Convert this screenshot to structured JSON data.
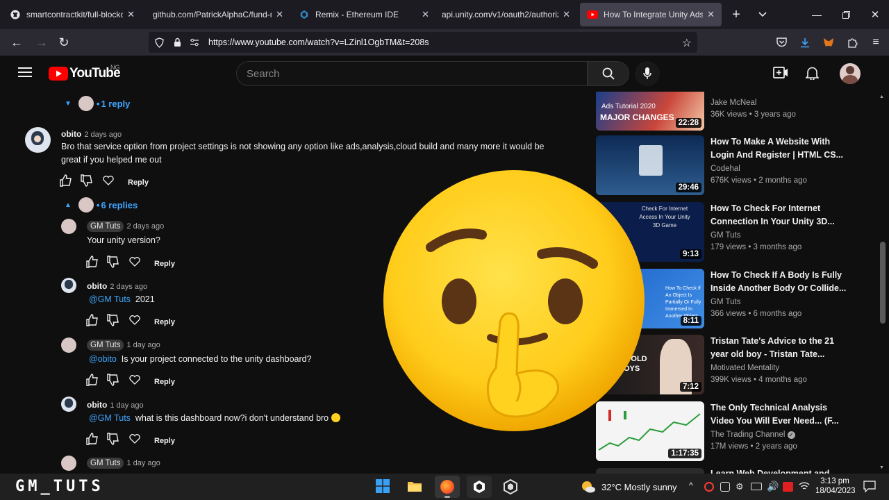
{
  "browser": {
    "tabs": [
      {
        "label": "smartcontractkit/full-blockcha",
        "icon": "github-icon"
      },
      {
        "label": "github.com/PatrickAlphaC/fund-m",
        "icon": "blank-icon"
      },
      {
        "label": "Remix - Ethereum IDE",
        "icon": "remix-icon"
      },
      {
        "label": "api.unity.com/v1/oauth2/authoriz",
        "icon": "blank-icon"
      },
      {
        "label": "How To Integrate Unity Ads In",
        "icon": "youtube-icon"
      }
    ],
    "url": "https://www.youtube.com/watch?v=LZinl1OgbTM&t=208s"
  },
  "youtube": {
    "logo": "YouTube",
    "country": "NG",
    "search_placeholder": "Search"
  },
  "comments": {
    "first_toggle": "1 reply",
    "main": {
      "author": "obito",
      "time": "2 days ago",
      "text": "Bro that service option from project settings is not showing any option like ads,analysis,cloud build and many more it would be great if you helped me out",
      "reply_label": "Reply",
      "replies_toggle": "6 replies"
    },
    "replies": [
      {
        "author": "GM Tuts",
        "time": "2 days ago",
        "mention": "",
        "text": "Your unity version?",
        "reply_label": "Reply"
      },
      {
        "author": "obito",
        "time": "2 days ago",
        "mention": "@GM Tuts",
        "text": "2021",
        "reply_label": "Reply"
      },
      {
        "author": "GM Tuts",
        "time": "1 day ago",
        "mention": "@obito",
        "text": "Is your project connected to the unity dashboard?",
        "reply_label": "Reply"
      },
      {
        "author": "obito",
        "time": "1 day ago",
        "mention": "@GM Tuts",
        "text": "what is this dashboard now?i don't understand bro",
        "reply_label": "Reply"
      },
      {
        "author": "GM Tuts",
        "time": "1 day ago",
        "mention": "",
        "text": "",
        "reply_label": ""
      }
    ]
  },
  "sidebar": [
    {
      "title_line1": "",
      "title_line2": "",
      "channel": "Jake McNeal",
      "meta": "36K views • 3 years ago",
      "duration": "22:28",
      "thumb_text1": "Ads Tutorial 2020",
      "thumb_text2": "MAJOR CHANGES"
    },
    {
      "title_line1": "How To Make A Website With",
      "title_line2": "Login And Register | HTML CS...",
      "channel": "Codehal",
      "meta": "676K views • 2 months ago",
      "duration": "29:46"
    },
    {
      "title_line1": "How To Check For Internet",
      "title_line2": "Connection In Your Unity 3D...",
      "channel": "GM Tuts",
      "meta": "179 views • 3 months ago",
      "duration": "9:13",
      "thumb_text1": "Check For Internet Access In Your Unity 3D Game"
    },
    {
      "title_line1": "How To Check If A Body Is Fully",
      "title_line2": "Inside Another Body Or Collide...",
      "channel": "GM Tuts",
      "meta": "366 views • 6 months ago",
      "duration": "8:11",
      "thumb_text1": "How To Check If An Object Is Partially Or Fully Immersed In Another Object"
    },
    {
      "title_line1": "Tristan Tate's Advice to the 21",
      "title_line2": "year old boy - Tristan Tate...",
      "channel": "Motivated Mentality",
      "meta": "399K views • 4 months ago",
      "duration": "7:12",
      "thumb_text1": "E OLD OYS"
    },
    {
      "title_line1": "The Only Technical Analysis",
      "title_line2": "Video You Will Ever Need... (F...",
      "channel": "The Trading Channel",
      "meta": "17M views • 2 years ago",
      "duration": "1:17:35"
    },
    {
      "title_line1": "Learn Web Development and",
      "title_line2": "",
      "channel": "",
      "meta": "",
      "duration": ""
    }
  ],
  "watermark": "GM_TUTS",
  "taskbar": {
    "weather": "32°C  Mostly sunny",
    "time": "3:13 pm",
    "date": "18/04/2023"
  },
  "colors": {
    "accent": "#3ea6ff",
    "youtube_red": "#ff0000",
    "emoji_yellow": "#ffd21f"
  }
}
